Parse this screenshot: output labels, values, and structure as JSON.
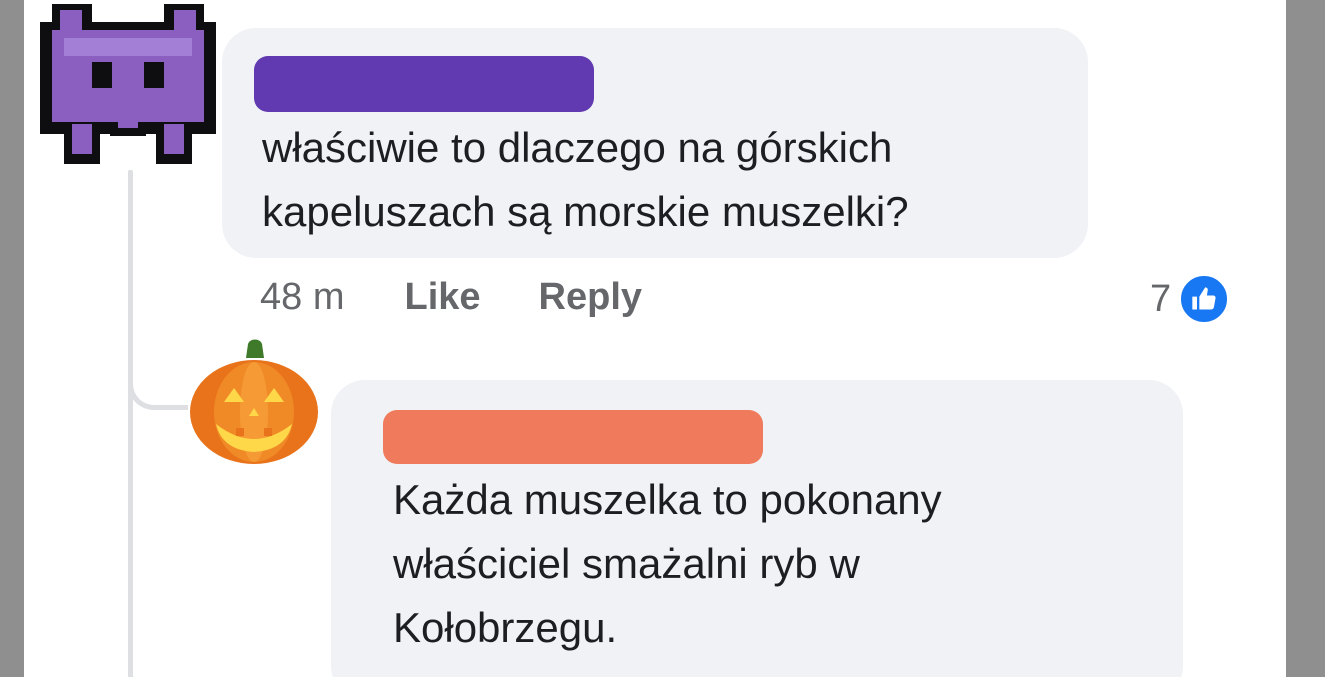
{
  "comments": [
    {
      "author": "",
      "avatar_icon": "alien-monster-icon",
      "text": "właściwie to dlaczego na górskich\nkapeluszach są morskie muszelki?",
      "time": "48 m",
      "like_label": "Like",
      "reply_label": "Reply",
      "reaction_count": "7",
      "reaction_icon": "thumbs-up-icon"
    },
    {
      "author": "",
      "avatar_icon": "jack-o-lantern-icon",
      "text": "Każda muszelka to pokonany\nwłaściciel smażalni ryb w\nKołobrzegu."
    }
  ],
  "colors": {
    "bubble": "#f0f2f5",
    "text": "#1c1e21",
    "secondary_text": "#65676b",
    "like_blue": "#1877f2",
    "redaction_purple": "#5f3ba8",
    "redaction_orange": "#ef7b5c"
  }
}
